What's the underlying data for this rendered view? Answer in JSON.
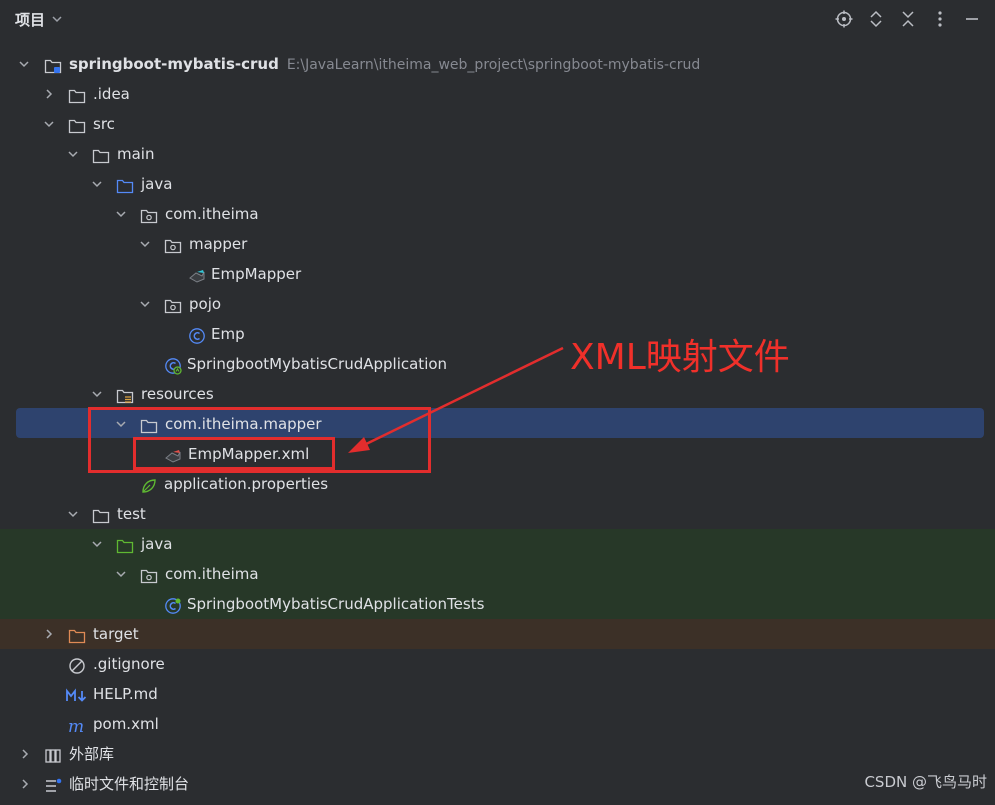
{
  "header": {
    "title": "项目",
    "icons": [
      "locate-icon",
      "expand-icon",
      "collapse-icon",
      "more-icon",
      "minimize-icon"
    ]
  },
  "tree": [
    {
      "label": "springboot-mybatis-crud",
      "path": "E:\\JavaLearn\\itheima_web_project\\springboot-mybatis-crud",
      "expanded": true,
      "icon": "module-folder"
    },
    {
      "label": ".idea",
      "expanded": false,
      "icon": "folder"
    },
    {
      "label": "src",
      "expanded": true,
      "icon": "folder"
    },
    {
      "label": "main",
      "expanded": true,
      "icon": "folder"
    },
    {
      "label": "java",
      "expanded": true,
      "icon": "source-folder"
    },
    {
      "label": "com.itheima",
      "expanded": true,
      "icon": "package"
    },
    {
      "label": "mapper",
      "expanded": true,
      "icon": "package"
    },
    {
      "label": "EmpMapper",
      "icon": "mapper-interface"
    },
    {
      "label": "pojo",
      "expanded": true,
      "icon": "package"
    },
    {
      "label": "Emp",
      "icon": "class"
    },
    {
      "label": "SpringbootMybatisCrudApplication",
      "icon": "spring-boot-class"
    },
    {
      "label": "resources",
      "expanded": true,
      "icon": "resources-folder"
    },
    {
      "label": "com.itheima.mapper",
      "expanded": true,
      "icon": "folder",
      "selected": true
    },
    {
      "label": "EmpMapper.xml",
      "icon": "mybatis-xml"
    },
    {
      "label": "application.properties",
      "icon": "spring-properties"
    },
    {
      "label": "test",
      "expanded": true,
      "icon": "folder"
    },
    {
      "label": "java",
      "expanded": true,
      "icon": "test-source-folder"
    },
    {
      "label": "com.itheima",
      "expanded": true,
      "icon": "package"
    },
    {
      "label": "SpringbootMybatisCrudApplicationTests",
      "icon": "spring-boot-test-class"
    },
    {
      "label": "target",
      "expanded": false,
      "icon": "excluded-folder"
    },
    {
      "label": ".gitignore",
      "icon": "ignore-file"
    },
    {
      "label": "HELP.md",
      "icon": "markdown-file"
    },
    {
      "label": "pom.xml",
      "icon": "maven-file"
    },
    {
      "label": "外部库",
      "expanded": false,
      "icon": "library"
    },
    {
      "label": "临时文件和控制台",
      "expanded": false,
      "icon": "scratches"
    }
  ],
  "annotation": {
    "text": "XML映射文件",
    "color": "#f0302a"
  },
  "watermark": "CSDN @飞鸟马时",
  "colors": {
    "background": "#2b2d30",
    "selection": "#2e436e",
    "test_band": "#273828",
    "excluded_band": "#3c3027",
    "annotation": "#e22d2d"
  }
}
